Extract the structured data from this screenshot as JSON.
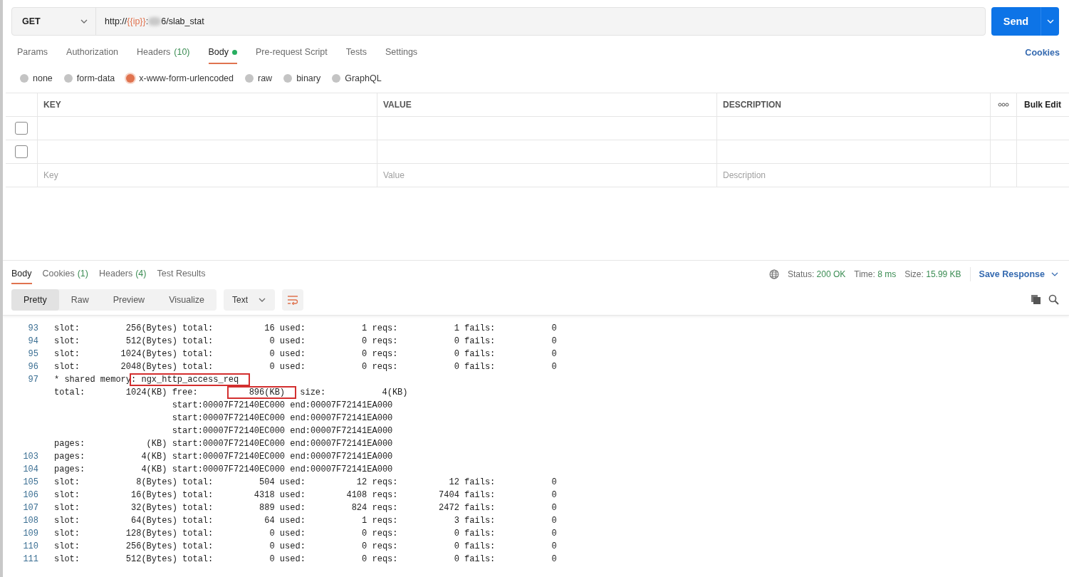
{
  "request": {
    "method": "GET",
    "url_parts": [
      {
        "kind": "text",
        "text": "http://"
      },
      {
        "kind": "variable",
        "text": "{{ip}}"
      },
      {
        "kind": "text",
        "text": ":"
      },
      {
        "kind": "redacted"
      },
      {
        "kind": "text",
        "text": "6/slab_stat"
      }
    ],
    "send": "Send"
  },
  "request_tabs": [
    {
      "label": "Params",
      "selected": false,
      "modified": false
    },
    {
      "label": "Authorization",
      "selected": false,
      "modified": false
    },
    {
      "label": "Headers",
      "count": "(10)",
      "selected": false,
      "modified": false
    },
    {
      "label": "Body",
      "selected": true,
      "modified": true
    },
    {
      "label": "Pre-request Script",
      "selected": false,
      "modified": false
    },
    {
      "label": "Tests",
      "selected": false,
      "modified": false
    },
    {
      "label": "Settings",
      "selected": false,
      "modified": false
    }
  ],
  "cookies_link": "Cookies",
  "body_types": [
    {
      "label": "none",
      "selected": false
    },
    {
      "label": "form-data",
      "selected": false
    },
    {
      "label": "x-www-form-urlencoded",
      "selected": true
    },
    {
      "label": "raw",
      "selected": false
    },
    {
      "label": "binary",
      "selected": false
    },
    {
      "label": "GraphQL",
      "selected": false
    }
  ],
  "params_table": {
    "columns": [
      "KEY",
      "VALUE",
      "DESCRIPTION"
    ],
    "bulk_edit": "Bulk Edit",
    "rows": [
      {
        "checked": false
      },
      {
        "checked": false
      }
    ],
    "placeholders": [
      "Key",
      "Value",
      "Description"
    ]
  },
  "response": {
    "tabs": [
      {
        "label": "Body",
        "selected": true
      },
      {
        "label": "Cookies",
        "count": "(1)",
        "selected": false
      },
      {
        "label": "Headers",
        "count": "(4)",
        "selected": false
      },
      {
        "label": "Test Results",
        "selected": false
      }
    ],
    "stats": [
      {
        "label": "Status:",
        "value": "200 OK"
      },
      {
        "label": "Time:",
        "value": "8 ms"
      },
      {
        "label": "Size:",
        "value": "15.99 KB"
      }
    ],
    "save": "Save Response",
    "view_modes": [
      {
        "label": "Pretty",
        "selected": true
      },
      {
        "label": "Raw",
        "selected": false
      },
      {
        "label": "Preview",
        "selected": false
      },
      {
        "label": "Visualize",
        "selected": false
      }
    ],
    "format": "Text",
    "wrap_lines": true,
    "lines": [
      {
        "number": "93",
        "parts": [
          {
            "text": "slot:         256(Bytes) total:          16 used:           1 reqs:           1 fails:           0",
            "boxed": false
          }
        ]
      },
      {
        "number": "94",
        "parts": [
          {
            "text": "slot:         512(Bytes) total:           0 used:           0 reqs:           0 fails:           0",
            "boxed": false
          }
        ]
      },
      {
        "number": "95",
        "parts": [
          {
            "text": "slot:        1024(Bytes) total:           0 used:           0 reqs:           0 fails:           0",
            "boxed": false
          }
        ]
      },
      {
        "number": "96",
        "parts": [
          {
            "text": "slot:        2048(Bytes) total:           0 used:           0 reqs:           0 fails:           0",
            "boxed": false
          }
        ]
      },
      {
        "number": "97",
        "parts": [
          {
            "text": "* shared memory",
            "boxed": false
          },
          {
            "text": ": ngx_http_access_req",
            "boxed": true
          }
        ]
      },
      {
        "parts": [
          {
            "text": "total:        1024(KB) free:      ",
            "boxed": false
          },
          {
            "text": "    896(KB)",
            "boxed": true
          },
          {
            "text": " size:           4(KB)",
            "boxed": false
          }
        ]
      },
      {
        "parts": [
          {
            "text": "                       start:00007F72140EC000 end:00007F72141EA000",
            "boxed": false
          }
        ]
      },
      {
        "parts": [
          {
            "text": "                       start:00007F72140EC000 end:00007F72141EA000",
            "boxed": false
          }
        ]
      },
      {
        "parts": [
          {
            "text": "                       start:00007F72140EC000 end:00007F72141EA000",
            "boxed": false
          }
        ]
      },
      {
        "parts": [
          {
            "text": "pages:            (KB) start:00007F72140EC000 end:00007F72141EA000",
            "boxed": false
          }
        ]
      },
      {
        "number": "103",
        "parts": [
          {
            "text": "pages:           4(KB) start:00007F72140EC000 end:00007F72141EA000",
            "boxed": false
          }
        ]
      },
      {
        "number": "104",
        "parts": [
          {
            "text": "pages:           4(KB) start:00007F72140EC000 end:00007F72141EA000",
            "boxed": false
          }
        ]
      },
      {
        "number": "105",
        "parts": [
          {
            "text": "slot:           8(Bytes) total:         504 used:          12 reqs:          12 fails:           0",
            "boxed": false
          }
        ]
      },
      {
        "number": "106",
        "parts": [
          {
            "text": "slot:          16(Bytes) total:        4318 used:        4108 reqs:        7404 fails:           0",
            "boxed": false
          }
        ]
      },
      {
        "number": "107",
        "parts": [
          {
            "text": "slot:          32(Bytes) total:         889 used:         824 reqs:        2472 fails:           0",
            "boxed": false
          }
        ]
      },
      {
        "number": "108",
        "parts": [
          {
            "text": "slot:          64(Bytes) total:          64 used:           1 reqs:           3 fails:           0",
            "boxed": false
          }
        ]
      },
      {
        "number": "109",
        "parts": [
          {
            "text": "slot:         128(Bytes) total:           0 used:           0 reqs:           0 fails:           0",
            "boxed": false
          }
        ]
      },
      {
        "number": "110",
        "parts": [
          {
            "text": "slot:         256(Bytes) total:           0 used:           0 reqs:           0 fails:           0",
            "boxed": false
          }
        ]
      },
      {
        "number": "111",
        "parts": [
          {
            "text": "slot:         512(Bytes) total:           0 used:           0 reqs:           0 fails:           0",
            "boxed": false
          }
        ]
      }
    ]
  }
}
